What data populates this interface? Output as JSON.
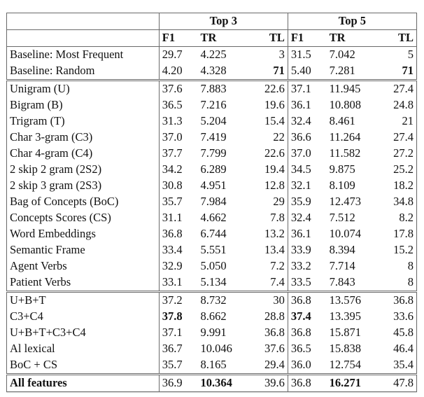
{
  "table": {
    "group_headers": [
      "Top 3",
      "Top 5"
    ],
    "metric_headers": [
      "F1",
      "TR",
      "TL",
      "F1",
      "TR",
      "TL"
    ],
    "groups": [
      {
        "name": "baselines",
        "rows": [
          {
            "label": "Baseline: Most Frequent",
            "values": [
              "29.7",
              "4.225",
              "3",
              "31.5",
              "7.042",
              "5"
            ],
            "bold": [
              false,
              false,
              false,
              false,
              false,
              false
            ]
          },
          {
            "label": "Baseline: Random",
            "values": [
              "4.20",
              "4.328",
              "71",
              "5.40",
              "7.281",
              "71"
            ],
            "bold": [
              false,
              false,
              true,
              false,
              false,
              true
            ]
          }
        ]
      },
      {
        "name": "single-features",
        "rows": [
          {
            "label": "Unigram (U)",
            "values": [
              "37.6",
              "7.883",
              "22.6",
              "37.1",
              "11.945",
              "27.4"
            ]
          },
          {
            "label": "Bigram (B)",
            "values": [
              "36.5",
              "7.216",
              "19.6",
              "36.1",
              "10.808",
              "24.8"
            ]
          },
          {
            "label": "Trigram (T)",
            "values": [
              "31.3",
              "5.204",
              "15.4",
              "32.4",
              "8.461",
              "21"
            ]
          },
          {
            "label": "Char 3-gram (C3)",
            "values": [
              "37.0",
              "7.419",
              "22",
              "36.6",
              "11.264",
              "27.4"
            ]
          },
          {
            "label": "Char 4-gram (C4)",
            "values": [
              "37.7",
              "7.799",
              "22.6",
              "37.0",
              "11.582",
              "27.2"
            ]
          },
          {
            "label": "2 skip 2 gram (2S2)",
            "values": [
              "34.2",
              "6.289",
              "19.4",
              "34.5",
              "9.875",
              "25.2"
            ]
          },
          {
            "label": "2 skip 3 gram (2S3)",
            "values": [
              "30.8",
              "4.951",
              "12.8",
              "32.1",
              "8.109",
              "18.2"
            ]
          },
          {
            "label": "Bag of Concepts (BoC)",
            "values": [
              "35.7",
              "7.984",
              "29",
              "35.9",
              "12.473",
              "34.8"
            ]
          },
          {
            "label": "Concepts Scores (CS)",
            "values": [
              "31.1",
              "4.662",
              "7.8",
              "32.4",
              "7.512",
              "8.2"
            ]
          },
          {
            "label": "Word Embeddings",
            "values": [
              "36.8",
              "6.744",
              "13.2",
              "36.1",
              "10.074",
              "17.8"
            ]
          },
          {
            "label": "Semantic Frame",
            "values": [
              "33.4",
              "5.551",
              "13.4",
              "33.9",
              "8.394",
              "15.2"
            ]
          },
          {
            "label": "Agent Verbs",
            "values": [
              "32.9",
              "5.050",
              "7.2",
              "33.2",
              "7.714",
              "8"
            ]
          },
          {
            "label": "Patient Verbs",
            "values": [
              "33.1",
              "5.134",
              "7.4",
              "33.5",
              "7.843",
              "8"
            ]
          }
        ]
      },
      {
        "name": "combinations",
        "rows": [
          {
            "label": "U+B+T",
            "values": [
              "37.2",
              "8.732",
              "30",
              "36.8",
              "13.576",
              "36.8"
            ]
          },
          {
            "label": "C3+C4",
            "values": [
              "37.8",
              "8.662",
              "28.8",
              "37.4",
              "13.395",
              "33.6"
            ],
            "bold": [
              true,
              false,
              false,
              true,
              false,
              false
            ]
          },
          {
            "label": "U+B+T+C3+C4",
            "values": [
              "37.1",
              "9.991",
              "36.8",
              "36.8",
              "15.871",
              "45.8"
            ]
          },
          {
            "label": "Al lexical",
            "values": [
              "36.7",
              "10.046",
              "37.6",
              "36.5",
              "15.838",
              "46.4"
            ]
          },
          {
            "label": "BoC + CS",
            "values": [
              "35.7",
              "8.165",
              "29.4",
              "36.0",
              "12.754",
              "35.4"
            ]
          }
        ]
      },
      {
        "name": "all",
        "rows": [
          {
            "label": "All features",
            "label_bold": true,
            "values": [
              "36.9",
              "10.364",
              "39.6",
              "36.8",
              "16.271",
              "47.8"
            ],
            "bold": [
              false,
              true,
              false,
              false,
              true,
              false
            ]
          }
        ]
      }
    ]
  }
}
